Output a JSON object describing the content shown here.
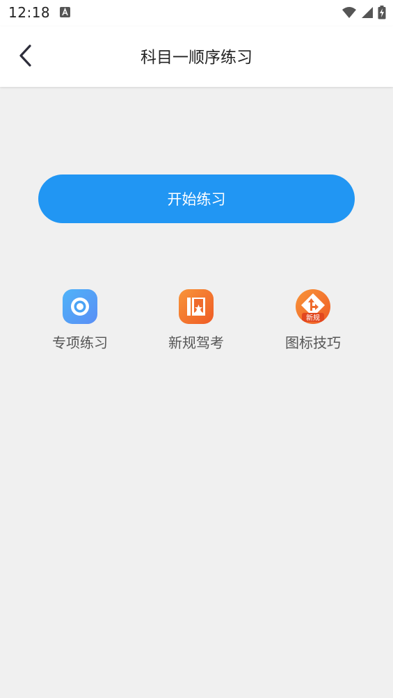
{
  "status_bar": {
    "time": "12:18",
    "icons": [
      "notification-a-icon",
      "wifi-icon",
      "signal-icon",
      "battery-charging-icon"
    ]
  },
  "header": {
    "back_icon": "chevron-left-icon",
    "title": "科目一顺序练习"
  },
  "main": {
    "start_button_label": "开始练习",
    "entries": [
      {
        "label": "专项练习",
        "icon": "target-icon",
        "color": "#4aa3f5"
      },
      {
        "label": "新规驾考",
        "icon": "new-rules-book-icon",
        "color": "#f36f2a"
      },
      {
        "label": "图标技巧",
        "icon": "sign-tips-icon",
        "color": "#f36f2a",
        "badge_text": "新规"
      }
    ]
  },
  "colors": {
    "accent": "#2196f3",
    "background": "#f0f0f0",
    "orange": "#f36f2a"
  }
}
